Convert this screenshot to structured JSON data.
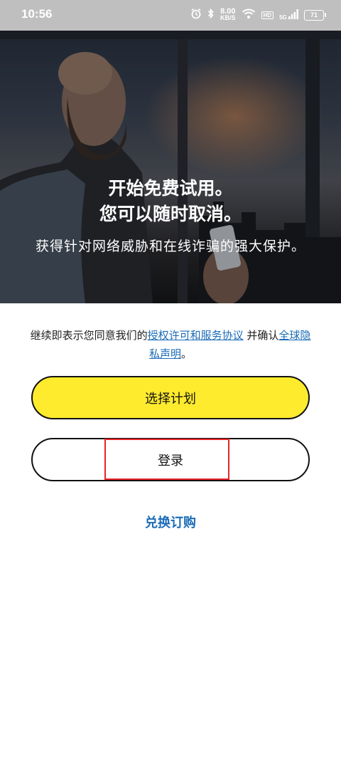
{
  "status_bar": {
    "time": "10:56",
    "net_speed_value": "8.00",
    "net_speed_unit": "KB/S",
    "hd_label": "HD",
    "network_label": "5G",
    "battery": "71",
    "icons": [
      "alarm-icon",
      "bluetooth-icon",
      "wifi-icon",
      "signal-icon"
    ]
  },
  "hero": {
    "title_line1": "开始免费试用。",
    "title_line2": "您可以随时取消。",
    "subtitle": "获得针对网络威胁和在线诈骗的强大保护。"
  },
  "consent": {
    "prefix": "继续即表示您同意我们的",
    "license_link": "授权许可和服务协议",
    "middle": " 并确认",
    "privacy_link": "全球隐私声明",
    "suffix": "。"
  },
  "buttons": {
    "choose_plan": "选择计划",
    "login": "登录",
    "redeem": "兑换订购"
  },
  "colors": {
    "accent_yellow": "#ffeb2e",
    "link_blue": "#1a6bb8",
    "highlight_red": "#e8232a"
  }
}
